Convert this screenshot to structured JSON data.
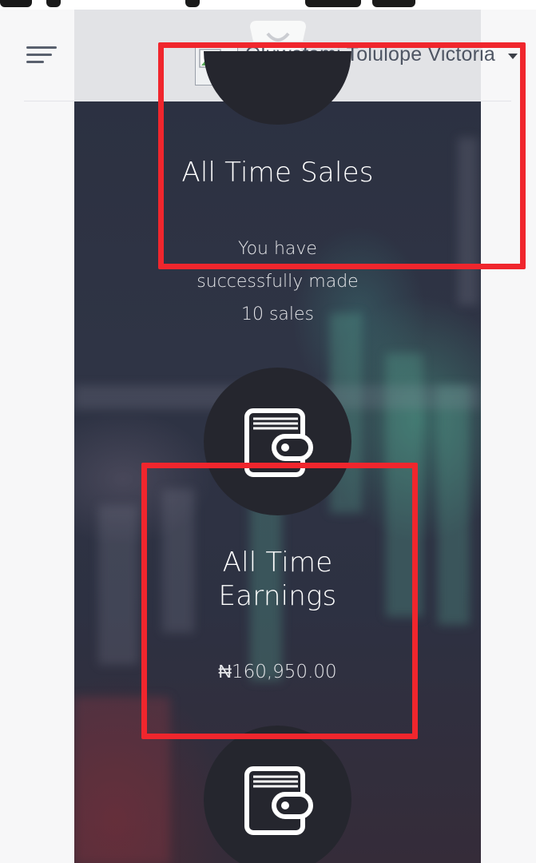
{
  "header": {
    "user_name": "Oluwafemi Tolulope Victoria",
    "icons": [
      "menu-icon",
      "avatar-broken-image-icon",
      "caret-down-icon",
      "shopping-bag-icon"
    ]
  },
  "stats": {
    "sales": {
      "title": "All Time Sales",
      "description_line1": "You have",
      "description_line2": "successfully made",
      "description_line3": "10 sales"
    },
    "earnings": {
      "title_line1": "All Time",
      "title_line2": "Earnings",
      "amount": "₦160,950.00",
      "icon": "wallet-icon"
    },
    "third": {
      "icon": "wallet-icon"
    }
  },
  "colors": {
    "annotation": "#f0262d",
    "panel": "#2d3142",
    "icon_circle": "#25262e",
    "header_bg": "#f0f1f3"
  }
}
